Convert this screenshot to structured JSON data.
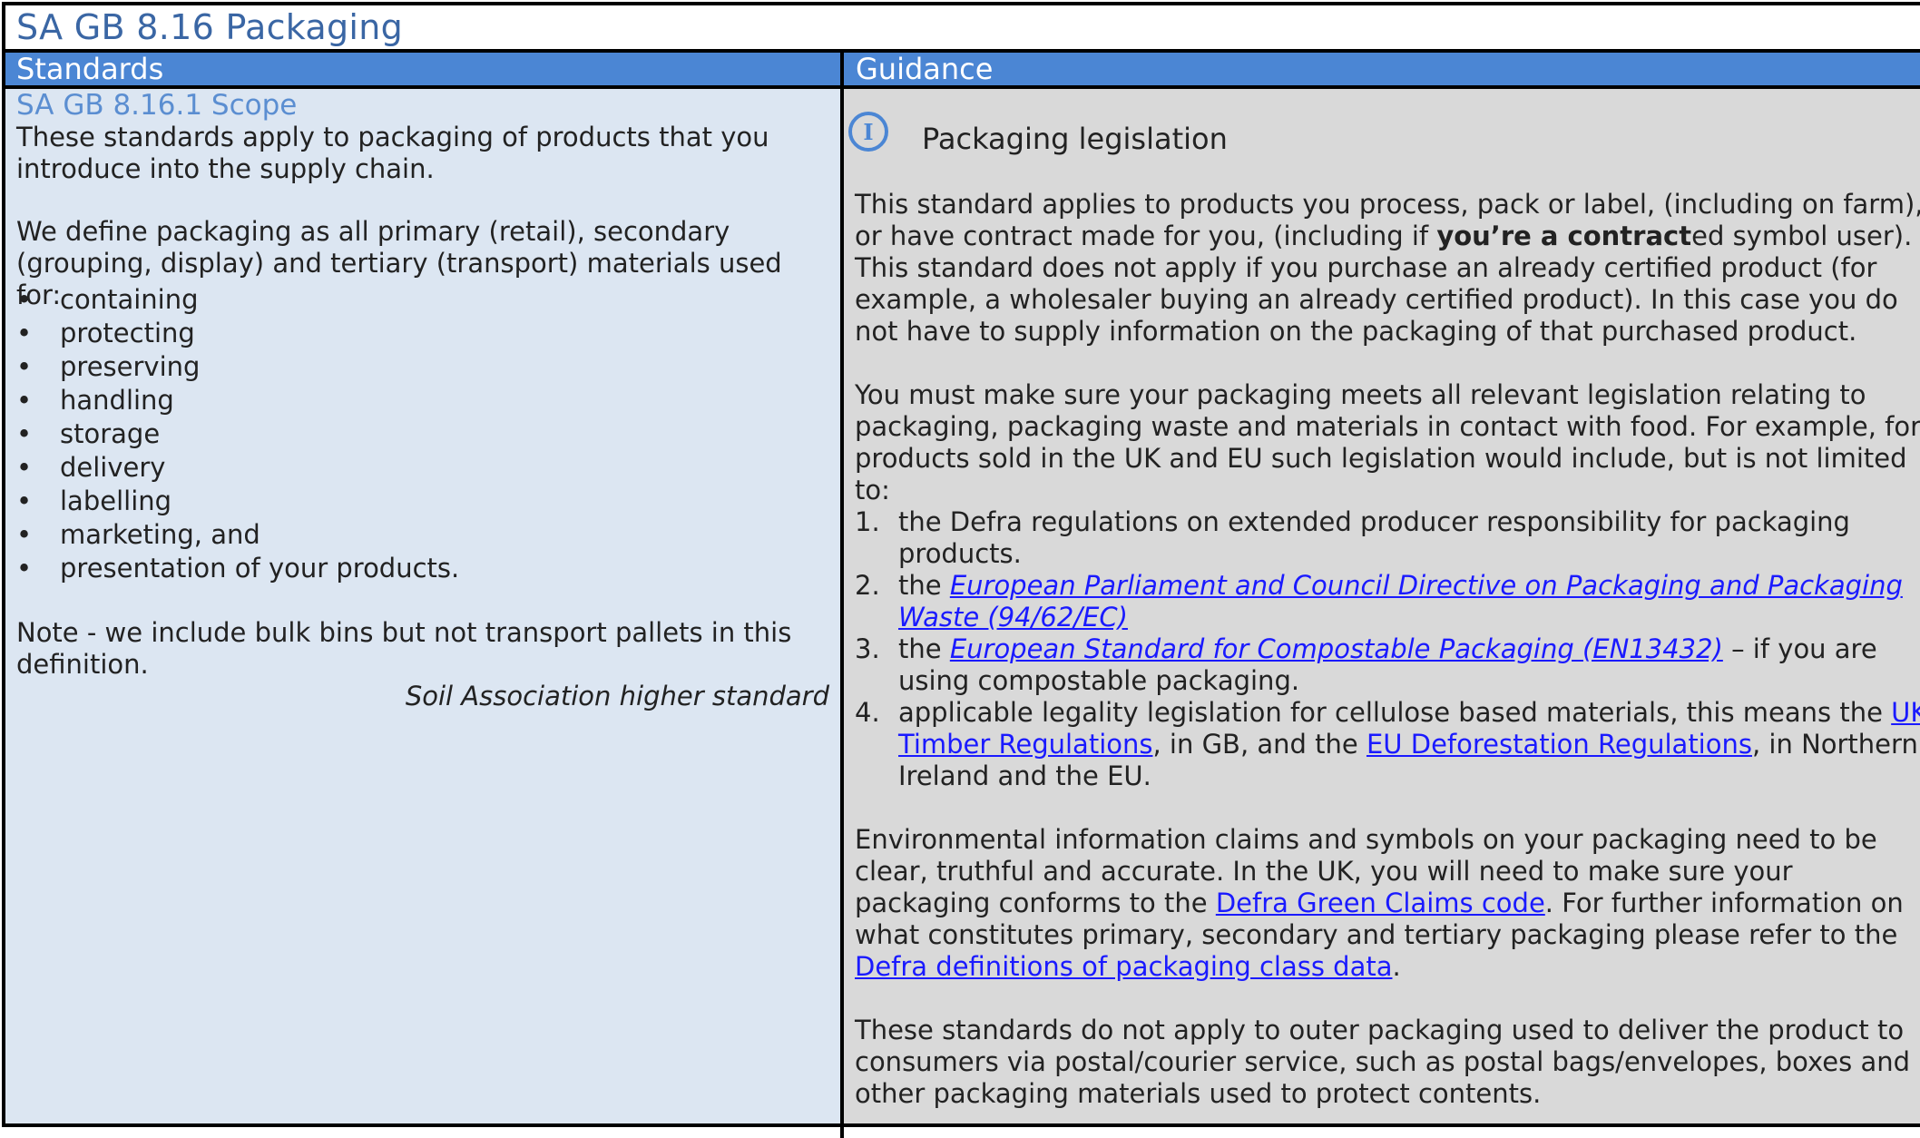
{
  "title": "SA GB 8.16 Packaging",
  "headers": {
    "standards": "Standards",
    "guidance": "Guidance"
  },
  "colors": {
    "header_bg": "#4b86d4",
    "left_bg": "#dce6f2",
    "right_bg": "#d9d9d9",
    "title_color": "#3a66a4",
    "scope_color": "#5b8ed1",
    "link_color": "#1a1aff"
  },
  "standards": {
    "scope_title": "SA GB 8.16.1 Scope",
    "intro": "These standards apply to packaging of products that you introduce into the supply chain.",
    "definition": "We define packaging as all primary (retail), secondary (grouping, display) and tertiary (transport) materials used for:",
    "bullets": [
      "containing",
      "protecting",
      "preserving",
      "handling",
      "storage",
      "delivery",
      "labelling",
      "marketing, and",
      "presentation of your products."
    ],
    "note": "Note - we include bulk bins but not transport pallets in this definition.",
    "higher_standard": "Soil Association higher standard"
  },
  "guidance": {
    "icon": "info-icon",
    "heading": "Packaging legislation",
    "p1_a": "This standard applies to products you process, pack or label, (including on farm), or have contract made for you, (including if ",
    "p1_bold": "you’re a contract",
    "p1_b": "ed symbol user). This standard does not apply if you purchase an already certified product (for example, a wholesaler buying an already certified product). In this case you do not have to supply information on the packaging of that purchased product.",
    "p2": "You must make sure your packaging meets all relevant legislation relating to packaging, packaging waste and materials in contact with food. For example, for products sold in the UK and EU such legislation would include, but is not limited to:",
    "list": {
      "n1": "1.",
      "n2": "2.",
      "n3": "3.",
      "n4": "4.",
      "i1": "the Defra regulations on extended producer responsibility for packaging products.",
      "i2_pre": "the ",
      "i2_link": "European Parliament and Council Directive on Packaging and Packaging Waste (94/62/EC)",
      "i3_pre": "the ",
      "i3_link": "European Standard for Compostable Packaging (EN13432)",
      "i3_post": " – if you are using compostable packaging.",
      "i4_pre": "applicable legality legislation for cellulose based materials, this means the ",
      "i4_link1": "UK Timber Regulations",
      "i4_mid": ", in GB, and the ",
      "i4_link2": "EU Deforestation Regulations",
      "i4_post": ", in Northern Ireland and the EU."
    },
    "p3_a": "Environmental information claims and symbols on your packaging need to be clear, truthful and accurate. In the UK, you will need to make sure your packaging conforms to the ",
    "p3_link1": "Defra Green Claims code",
    "p3_b": ". For further information on what constitutes primary, secondary and tertiary packaging please refer to the ",
    "p3_link2": "Defra definitions of packaging class data",
    "p3_c": ".",
    "p4": "These standards do not apply to outer packaging used to deliver the product to consumers via postal/courier service, such as postal bags/envelopes, boxes and other packaging materials used to protect contents."
  }
}
